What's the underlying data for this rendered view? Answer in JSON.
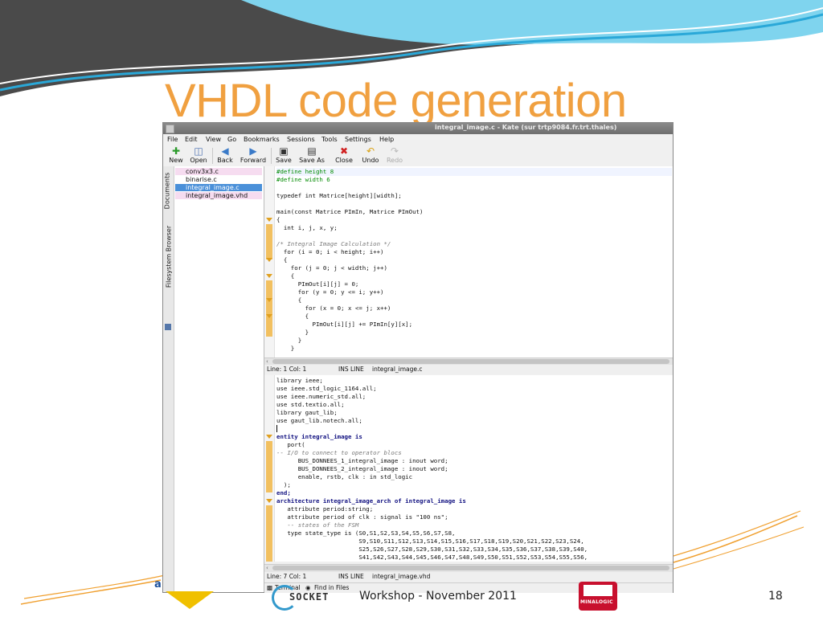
{
  "slide": {
    "title": "VHDL code generation",
    "footer": "Workshop - November 2011",
    "page_number": "18",
    "logos": {
      "left_letter": "a",
      "socket_word": "SOCKET",
      "minalogic_word": "MINALOGIC"
    }
  },
  "window": {
    "title": "integral_image.c - Kate (sur trtp9084.fr.trt.thales)"
  },
  "menu": [
    "File",
    "Edit",
    "View",
    "Go",
    "Bookmarks",
    "Sessions",
    "Tools",
    "Settings",
    "Help"
  ],
  "toolbar": {
    "new": "New",
    "open": "Open",
    "back": "Back",
    "forward": "Forward",
    "save": "Save",
    "save_as": "Save As",
    "close": "Close",
    "undo": "Undo",
    "redo": "Redo"
  },
  "side_tabs": {
    "documents": "Documents",
    "filesystem": "Filesystem Browser"
  },
  "documents": [
    {
      "name": "conv3x3.c",
      "state": "modified"
    },
    {
      "name": "binarise.c",
      "state": "normal"
    },
    {
      "name": "integral_image.c",
      "state": "selected"
    },
    {
      "name": "integral_image.vhd",
      "state": "modified"
    }
  ],
  "status_top": {
    "position": "Line: 1 Col: 1",
    "mode": "INS  LINE",
    "file": "integral_image.c"
  },
  "status_bottom": {
    "position": "Line: 7 Col: 1",
    "mode": "INS  LINE",
    "file": "integral_image.vhd"
  },
  "bottom_tabs": {
    "terminal": "Terminal",
    "find": "Find in Files"
  },
  "c_code": [
    "#define height 8",
    "#define width 6",
    "",
    "typedef int Matrice[height][width];",
    "",
    "main(const Matrice PImIn, Matrice PImOut)",
    "{",
    "  int i, j, x, y;",
    "",
    "/* Integral Image Calculation */",
    "  for (i = 0; i < height; i++)",
    "  {",
    "    for (j = 0; j < width; j++)",
    "    {",
    "      PImOut[i][j] = 0;",
    "      for (y = 0; y <= i; y++)",
    "      {",
    "        for (x = 0; x <= j; x++)",
    "        {",
    "          PImOut[i][j] += PImIn[y][x];",
    "        }",
    "      }",
    "    }"
  ],
  "vhdl_code": [
    "library ieee;",
    "use ieee.std_logic_1164.all;",
    "use ieee.numeric_std.all;",
    "use std.textio.all;",
    "library gaut_lib;",
    "use gaut_lib.notech.all;",
    "",
    "entity integral_image is",
    "   port(",
    "-- I/O to connect to operator blocs",
    "      BUS_DONNEES_1_integral_image : inout word;",
    "      BUS_DONNEES_2_integral_image : inout word;",
    "      enable, rstb, clk : in std_logic",
    "  );",
    "end;",
    "architecture integral_image_arch of integral_image is",
    "   attribute period:string;",
    "   attribute period of clk : signal is \"100 ns\";",
    "   -- states of the FSM",
    "   type state_type is (S0,S1,S2,S3,S4,S5,S6,S7,S8,",
    "                       S9,S10,S11,S12,S13,S14,S15,S16,S17,S18,S19,S20,S21,S22,S23,S24,",
    "                       S25,S26,S27,S28,S29,S30,S31,S32,S33,S34,S35,S36,S37,S38,S39,S40,",
    "                       S41,S42,S43,S44,S45,S46,S47,S48,S49,S50,S51,S52,S53,S54,S55,S56,"
  ]
}
